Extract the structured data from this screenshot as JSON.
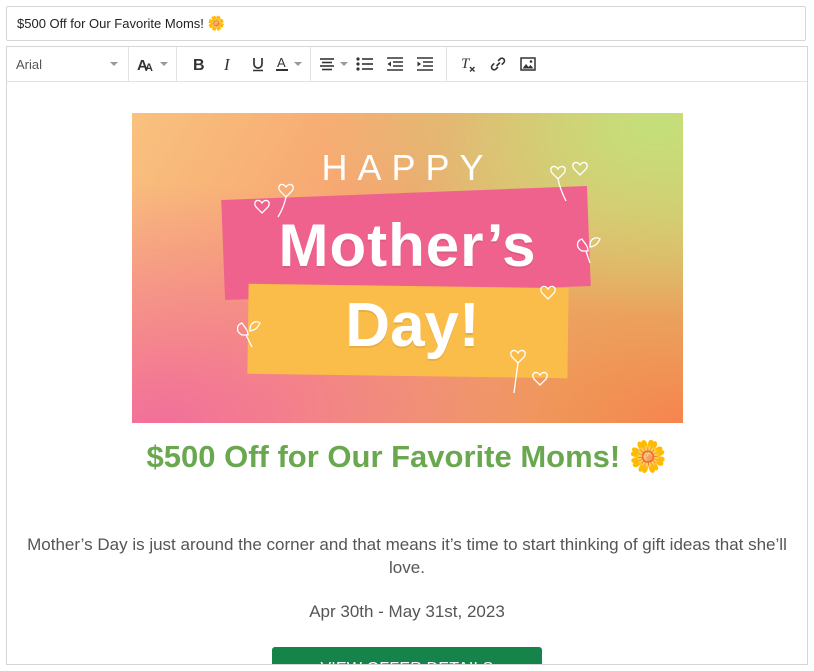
{
  "subject": {
    "text": "$500 Off for Our Favorite Moms!",
    "emoji": "🌼"
  },
  "toolbar": {
    "font_name": "Arial",
    "buttons": [
      "font-size",
      "bold",
      "italic",
      "underline",
      "text-color",
      "align",
      "bulleted-list",
      "outdent",
      "indent",
      "clear-formatting",
      "link",
      "image"
    ]
  },
  "hero": {
    "line1": "HAPPY",
    "line2": "Mother’s",
    "line3": "Day!"
  },
  "email": {
    "headline": "$500 Off for Our Favorite Moms!",
    "headline_emoji": "🌼",
    "body": "Mother’s Day is just around the corner and that means it’s time to start thinking of gift ideas that she’ll love.",
    "dates": "Apr 30th - May 31st, 2023",
    "cta_label": "VIEW OFFER DETAILS"
  },
  "colors": {
    "headline": "#6aa84f",
    "cta_background": "#16834a",
    "pink_band": "#f0628e",
    "yellow_band": "#fbbd4a"
  }
}
